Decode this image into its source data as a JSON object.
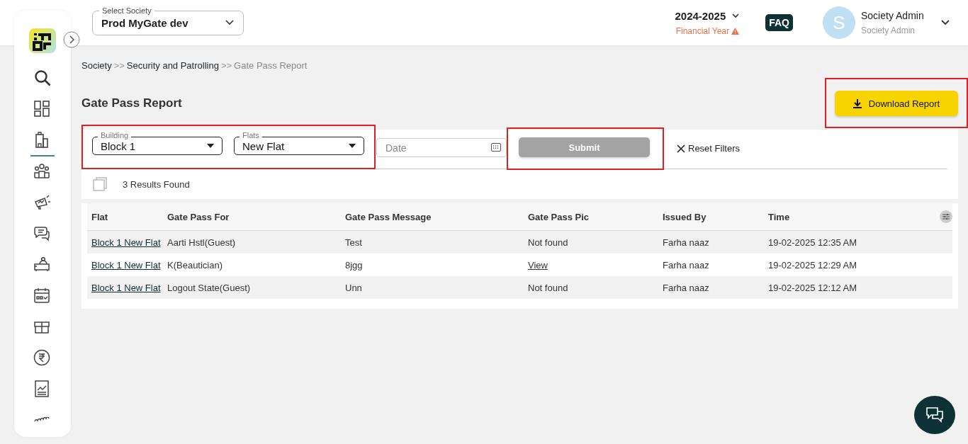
{
  "header": {
    "society_select": {
      "label": "Select Society",
      "value": "Prod MyGate dev"
    },
    "year": "2024-2025",
    "year_note": "Financial Year",
    "faq": "FAQ",
    "user": {
      "initial": "S",
      "name": "Society Admin",
      "role": "Society Admin"
    }
  },
  "sidebar": {
    "items": [
      {
        "selected": false
      },
      {
        "selected": false
      },
      {
        "selected": true
      },
      {
        "selected": false
      },
      {
        "selected": false
      },
      {
        "selected": false
      },
      {
        "selected": false
      },
      {
        "selected": false
      },
      {
        "selected": false
      },
      {
        "selected": false
      },
      {
        "selected": false
      },
      {
        "selected": false
      }
    ]
  },
  "breadcrumb": [
    {
      "text": "Society",
      "current": false
    },
    {
      "text": "Security and Patrolling",
      "current": false
    },
    {
      "text": "Gate Pass Report",
      "current": true
    }
  ],
  "separator": ">>",
  "page_title": "Gate Pass Report",
  "download_button": {
    "label": "Download Report",
    "highlighted": true
  },
  "filters": {
    "highlighted": true,
    "building": {
      "label": "Building",
      "value": "Block 1"
    },
    "flats": {
      "label": "Flats",
      "value": "New Flat"
    },
    "date": {
      "placeholder": "Date"
    },
    "submit": {
      "label": "Submit",
      "highlighted": true,
      "disabled": true
    },
    "reset": "Reset Filters"
  },
  "results": "3 Results Found",
  "table": {
    "columns": [
      "Flat",
      "Gate Pass For",
      "Gate Pass Message",
      "Gate Pass Pic",
      "Issued By",
      "Time"
    ],
    "rows": [
      {
        "flat": "Block 1 New Flat",
        "for": "Aarti Hstl(Guest)",
        "message": "Test",
        "pic": {
          "text": "Not found",
          "kind": "text"
        },
        "issued_by": "Farha naaz",
        "time": "19-02-2025 12:35 AM"
      },
      {
        "flat": "Block 1 New Flat",
        "for": "K(Beautician)",
        "message": "8jgg",
        "pic": {
          "text": "View",
          "kind": "link"
        },
        "issued_by": "Farha naaz",
        "time": "19-02-2025 12:29 AM"
      },
      {
        "flat": "Block 1 New Flat",
        "for": "Logout State(Guest)",
        "message": "Unn",
        "pic": {
          "text": "Not found",
          "kind": "text"
        },
        "issued_by": "Farha naaz",
        "time": "19-02-2025 12:12 AM"
      }
    ]
  }
}
